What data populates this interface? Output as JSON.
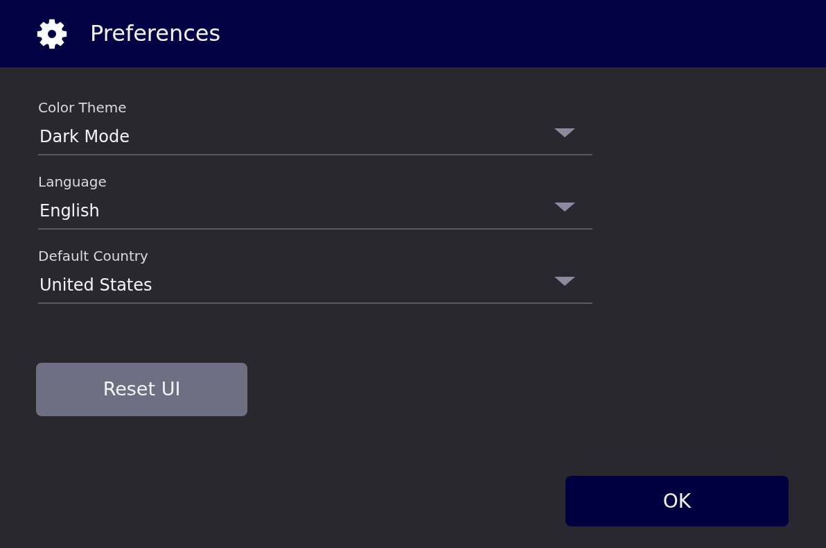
{
  "window": {
    "title": "Preferences"
  },
  "settings": [
    {
      "label": "Color Theme",
      "value": "Dark Mode"
    },
    {
      "label": "Language",
      "value": "English"
    },
    {
      "label": "Default Country",
      "value": "United States"
    }
  ],
  "buttons": [
    {
      "label": "Reset UI",
      "kind": "secondary"
    },
    {
      "label": "OK",
      "kind": "primary"
    }
  ]
}
